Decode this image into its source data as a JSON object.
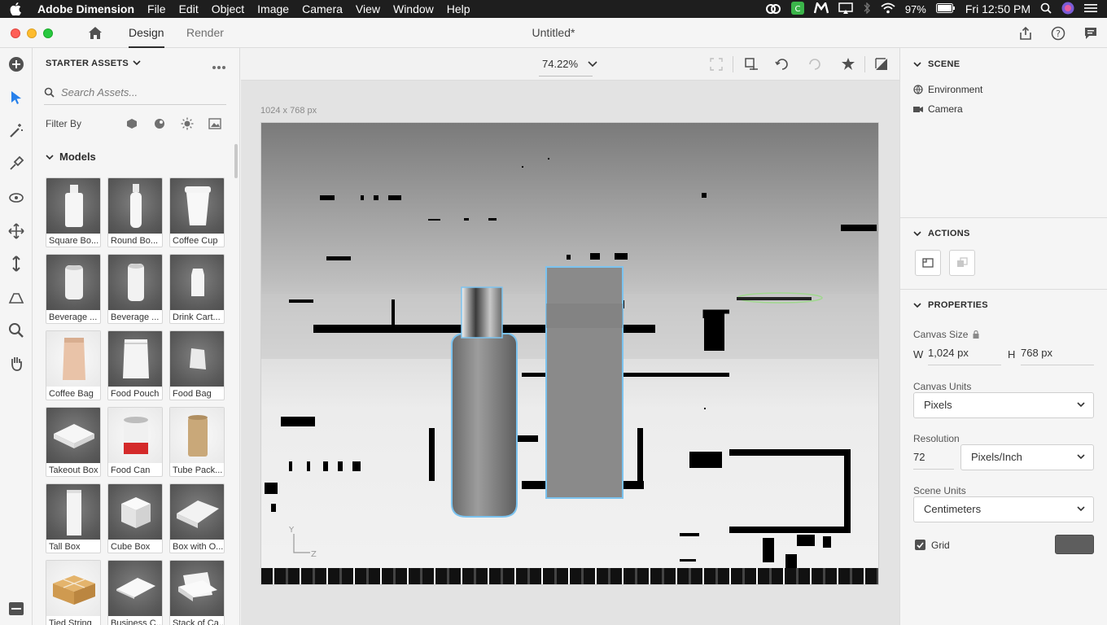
{
  "menubar": {
    "app_name": "Adobe Dimension",
    "items": [
      "File",
      "Edit",
      "Object",
      "Image",
      "Camera",
      "View",
      "Window",
      "Help"
    ],
    "battery": "97%",
    "clock": "Fri 12:50 PM"
  },
  "titlebar": {
    "tabs": [
      "Design",
      "Render"
    ],
    "active_tab": "Design",
    "document_title": "Untitled*"
  },
  "assets": {
    "header": "STARTER ASSETS",
    "search_placeholder": "Search Assets...",
    "filter_label": "Filter By",
    "section_title": "Models",
    "models": [
      {
        "label": "Square Bo...",
        "icon": "square-bottle-icon"
      },
      {
        "label": "Round Bo...",
        "icon": "round-bottle-icon"
      },
      {
        "label": "Coffee Cup",
        "icon": "coffee-cup-icon"
      },
      {
        "label": "Beverage ...",
        "icon": "beverage-can-icon"
      },
      {
        "label": "Beverage ...",
        "icon": "beverage-can-icon"
      },
      {
        "label": "Drink Cart...",
        "icon": "drink-carton-icon"
      },
      {
        "label": "Coffee Bag",
        "icon": "coffee-bag-icon"
      },
      {
        "label": "Food Pouch",
        "icon": "food-pouch-icon"
      },
      {
        "label": "Food Bag",
        "icon": "food-bag-icon"
      },
      {
        "label": "Takeout Box",
        "icon": "takeout-box-icon"
      },
      {
        "label": "Food Can",
        "icon": "food-can-icon"
      },
      {
        "label": "Tube Pack...",
        "icon": "tube-package-icon"
      },
      {
        "label": "Tall Box",
        "icon": "tall-box-icon"
      },
      {
        "label": "Cube Box",
        "icon": "cube-box-icon"
      },
      {
        "label": "Box with O...",
        "icon": "box-open-icon"
      },
      {
        "label": "Tied String",
        "icon": "tied-string-box-icon"
      },
      {
        "label": "Business C...",
        "icon": "business-card-icon"
      },
      {
        "label": "Stack of Ca...",
        "icon": "card-stack-icon"
      }
    ]
  },
  "viewport": {
    "zoom": "74.22%",
    "canvas_size_label": "1024 x 768 px"
  },
  "scene": {
    "header": "SCENE",
    "items": [
      "Environment",
      "Camera"
    ]
  },
  "actions": {
    "header": "ACTIONS"
  },
  "properties": {
    "header": "PROPERTIES",
    "canvas_size_label": "Canvas Size",
    "w_label": "W",
    "w_value": "1,024 px",
    "h_label": "H",
    "h_value": "768 px",
    "canvas_units_label": "Canvas Units",
    "canvas_units_value": "Pixels",
    "resolution_label": "Resolution",
    "resolution_value": "72",
    "resolution_unit": "Pixels/Inch",
    "scene_units_label": "Scene Units",
    "scene_units_value": "Centimeters",
    "grid_label": "Grid",
    "grid_checked": true,
    "grid_color": "#5e5e5e"
  }
}
